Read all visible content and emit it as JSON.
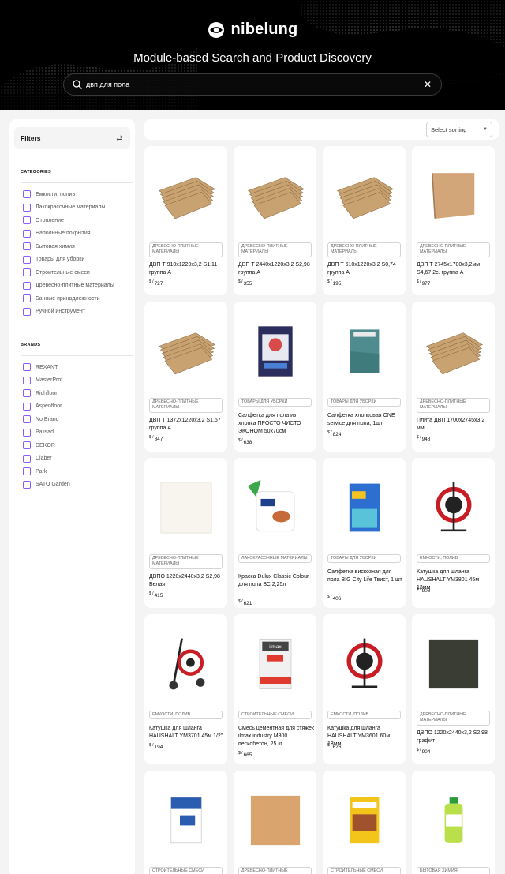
{
  "hero": {
    "logo_text": "nibelung",
    "title": "Module-based Search and Product Discovery",
    "search_value": "двп для пола"
  },
  "sidebar": {
    "filters_label": "Filters",
    "categories_title": "CATEGORIES",
    "categories": [
      "Емкости, полив",
      "Лакокрасочные материалы",
      "Отопление",
      "Напольные покрытия",
      "Бытовая химия",
      "Товары для уборки",
      "Строительные смеси",
      "Древесно-плитные материалы",
      "Банные принадлежности",
      "Ручной инструмент"
    ],
    "brands_title": "BRANDS",
    "brands": [
      "REXANT",
      "MasterProf",
      "Richfloor",
      "Aspenfloor",
      "No Brand",
      "Palisad",
      "DEKOR",
      "Claber",
      "Park",
      "SATO Garden"
    ]
  },
  "sort": {
    "label": "Select sorting"
  },
  "currency": "$ /",
  "products": [
    {
      "category": "Древесно-плитные материалы",
      "name": "ДВП Т 910х1220х3,2 S1,11 группа А",
      "price": "727",
      "icon": "fiberboard-stack"
    },
    {
      "category": "Древесно-плитные материалы",
      "name": "ДВП Т 2440х1220х3,2 S2,98 группа А",
      "price": "355",
      "icon": "fiberboard-stack"
    },
    {
      "category": "Древесно-плитные материалы",
      "name": "ДВП Т 610х1220х3,2 S0,74 группа А",
      "price": "195",
      "icon": "fiberboard-stack"
    },
    {
      "category": "Древесно-плитные материалы",
      "name": "ДВП Т 2745х1700х3,2мм S4,67 2с. группа А",
      "price": "977",
      "icon": "fiberboard-sheet"
    },
    {
      "category": "Древесно-плитные материалы",
      "name": "ДВП Т 1372х1220х3,2 S1,67 группа А",
      "price": "847",
      "icon": "fiberboard-stack"
    },
    {
      "category": "Товары для уборки",
      "name": "Салфетка для пола из хлопка ПРОСТО ЧИСТО ЭКОНОМ 50х70см",
      "price": "638",
      "icon": "floor-cloth-pack"
    },
    {
      "category": "Товары для уборки",
      "name": "Салфетка хлопковая ONE service для пола, 1шт",
      "price": "824",
      "icon": "cotton-cloth"
    },
    {
      "category": "Древесно-плитные материалы",
      "name": "Плита ДВП 1700х2745х3.2 мм",
      "price": "948",
      "icon": "fiberboard-stack"
    },
    {
      "category": "Древесно-плитные материалы",
      "name": "ДВПО 1220х2440х3,2 S2,98 Белая",
      "price": "415",
      "icon": "white-board"
    },
    {
      "category": "Лакокрасочные материалы",
      "name": "Краска Dulux Classic Colour для пола ВС 2,25л",
      "price": "621",
      "icon": "paint-bucket"
    },
    {
      "category": "Товары для уборки",
      "name": "Салфетка вискозная для пола BIG City Life Твист, 1 шт",
      "price": "406",
      "icon": "viscose-cloth-pack"
    },
    {
      "category": "Емкости, полив",
      "name": "Катушка для шланга HAUSHALT YM3801 45м 13мм",
      "price": "908",
      "icon": "hose-reel"
    },
    {
      "category": "Емкости, полив",
      "name": "Катушка для шланга HAUSHALT YM3701 45м 1/2\"",
      "price": "194",
      "icon": "hose-cart"
    },
    {
      "category": "Строительные смеси",
      "name": "Смесь цементная для стяжек ilmax industry M300 пескобетон, 25 кг",
      "price": "665",
      "icon": "cement-bag"
    },
    {
      "category": "Емкости, полив",
      "name": "Катушка для шланга HAUSHALT YM3601 60м 13мм",
      "price": "626",
      "icon": "hose-reel"
    },
    {
      "category": "Древесно-плитные материалы",
      "name": "ДВПО 1220х2440х3,2 S2,98 графит",
      "price": "904",
      "icon": "graphite-board"
    },
    {
      "category": "Строительные смеси",
      "name": "",
      "price": "",
      "icon": "mix-bag-blue"
    },
    {
      "category": "Древесно-плитные материалы",
      "name": "",
      "price": "",
      "icon": "wood-panel"
    },
    {
      "category": "Строительные смеси",
      "name": "",
      "price": "",
      "icon": "wonder-bag"
    },
    {
      "category": "Бытовая химия",
      "name": "",
      "price": "",
      "icon": "cleaner-bottle"
    }
  ]
}
